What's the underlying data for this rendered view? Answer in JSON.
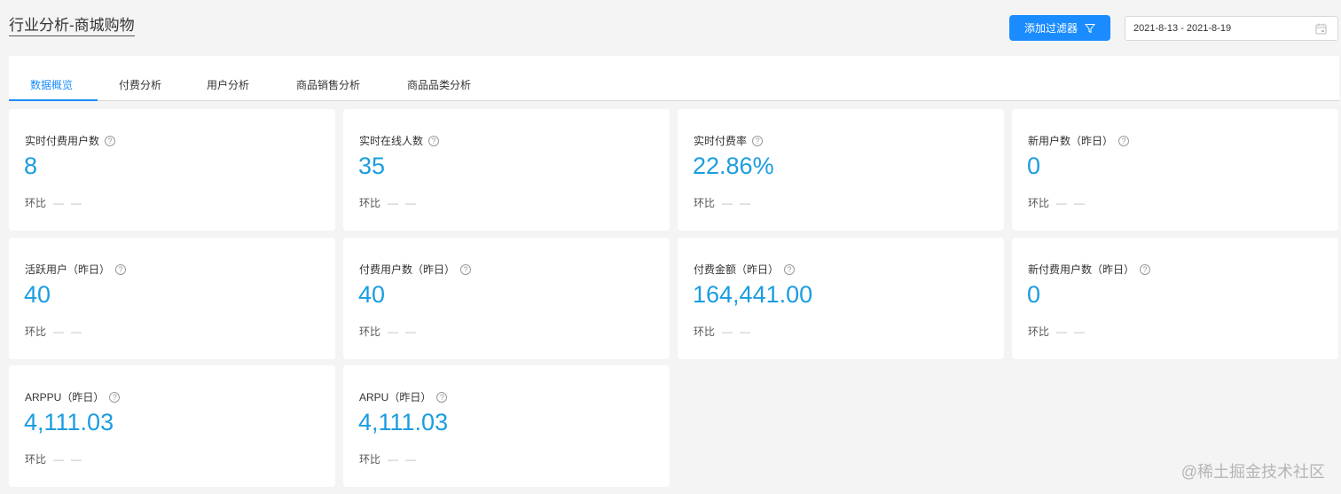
{
  "header": {
    "title": "行业分析-商城购物",
    "filter_button": "添加过滤器",
    "date_range": "2021-8-13 - 2021-8-19"
  },
  "tabs": [
    {
      "label": "数据概览",
      "active": true
    },
    {
      "label": "付费分析",
      "active": false
    },
    {
      "label": "用户分析",
      "active": false
    },
    {
      "label": "商品销售分析",
      "active": false
    },
    {
      "label": "商品品类分析",
      "active": false
    }
  ],
  "ratio_label": "环比",
  "ratio_dash1": "—",
  "ratio_dash2": "—",
  "help_glyph": "?",
  "cards": [
    {
      "label": "实时付费用户数",
      "value": "8"
    },
    {
      "label": "实时在线人数",
      "value": "35"
    },
    {
      "label": "实时付费率",
      "value": "22.86%"
    },
    {
      "label": "新用户数（昨日）",
      "value": "0"
    },
    {
      "label": "活跃用户（昨日）",
      "value": "40"
    },
    {
      "label": "付费用户数（昨日）",
      "value": "40"
    },
    {
      "label": "付费金额（昨日）",
      "value": "164,441.00"
    },
    {
      "label": "新付费用户数（昨日）",
      "value": "0"
    },
    {
      "label": "ARPPU（昨日）",
      "value": "4,111.03"
    },
    {
      "label": "ARPU（昨日）",
      "value": "4,111.03"
    }
  ],
  "watermark": "@稀土掘金技术社区",
  "colors": {
    "accent": "#1a8cff",
    "value": "#1a9de0",
    "background": "#f4f4f4"
  }
}
